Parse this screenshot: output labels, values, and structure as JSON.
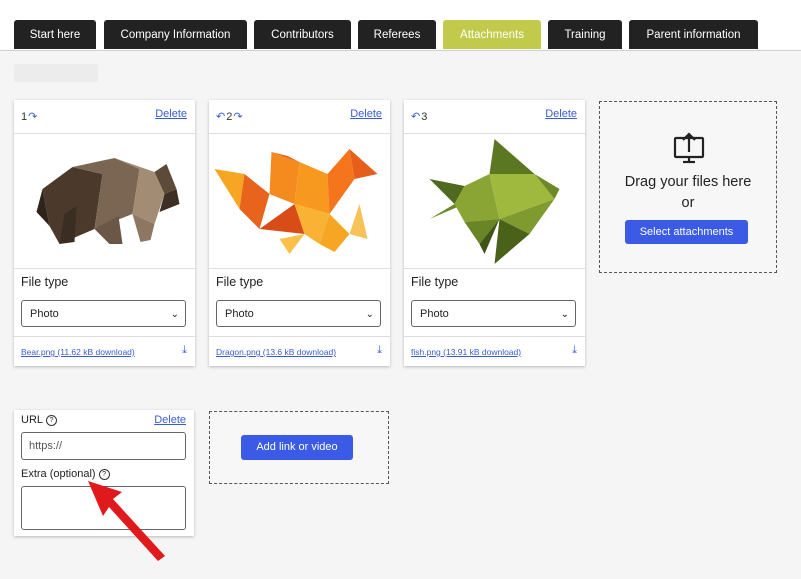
{
  "tabs": [
    {
      "label": "Start here",
      "active": false
    },
    {
      "label": "Company Information",
      "active": false
    },
    {
      "label": "Contributors",
      "active": false
    },
    {
      "label": "Referees",
      "active": false
    },
    {
      "label": "Attachments",
      "active": true
    },
    {
      "label": "Training",
      "active": false
    },
    {
      "label": "Parent information",
      "active": false
    }
  ],
  "cards": [
    {
      "order": "1",
      "delete": "Delete",
      "file_type_label": "File type",
      "file_type": "Photo",
      "file_link": "Bear.png (11.62 kB download)",
      "image": "bear"
    },
    {
      "order": "2",
      "delete": "Delete",
      "file_type_label": "File type",
      "file_type": "Photo",
      "file_link": "Dragon.png (13.6 kB download)",
      "image": "dragon"
    },
    {
      "order": "3",
      "delete": "Delete",
      "file_type_label": "File type",
      "file_type": "Photo",
      "file_link": "fish.png (13.91 kB download)",
      "image": "fish"
    }
  ],
  "dropzone": {
    "line1": "Drag your files here",
    "line2": "or",
    "button": "Select attachments",
    "icon": "upload-icon"
  },
  "url_card": {
    "url_label": "URL",
    "delete": "Delete",
    "url_placeholder": "https://",
    "extra_label": "Extra (optional)"
  },
  "link_zone": {
    "button": "Add link or video"
  },
  "colors": {
    "accent": "#3b5ae6",
    "active_tab": "#c1ca4a",
    "tab": "#222222",
    "annotation_arrow": "#e0191c"
  }
}
